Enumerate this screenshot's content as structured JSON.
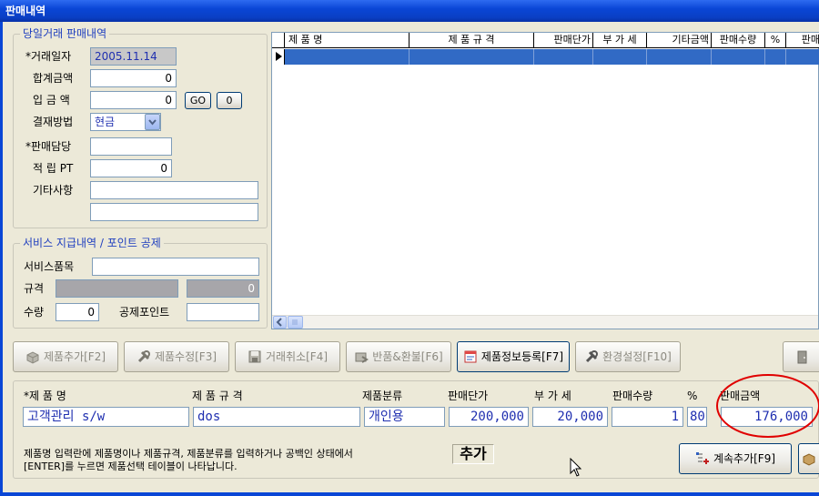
{
  "window": {
    "title": "판매내역"
  },
  "today_sales": {
    "legend": "당일거래 판매내역",
    "date_label": "*거래일자",
    "date_value": "2005.11.14",
    "total_label": "합계금액",
    "total_value": "0",
    "deposit_label": "입 금 액",
    "deposit_value": "0",
    "go_label": "GO",
    "zero_label": "0",
    "payment_label": "결재방법",
    "payment_value": "현금",
    "staff_label": "*판매담당",
    "staff_value": "",
    "points_label": "적 립 PT",
    "points_value": "0",
    "notes_label": "기타사항",
    "notes_value1": "",
    "notes_value2": ""
  },
  "service": {
    "legend": "서비스 지급내역 / 포인트 공제",
    "item_label": "서비스품목",
    "item_value": "",
    "spec_label": "규격",
    "spec_value": "",
    "spec_num": "0",
    "qty_label": "수량",
    "qty_value": "0",
    "deduct_label": "공제포인트",
    "deduct_value": ""
  },
  "grid": {
    "columns": [
      "제  품  명",
      "제  품  규  격",
      "판매단가",
      "부 가 세",
      "기타금액",
      "판매수량",
      "%",
      "판매"
    ]
  },
  "toolbar": {
    "add_product": "제품추가[F2]",
    "edit_product": "제품수정[F3]",
    "cancel_deal": "거래취소[F4]",
    "return_refund": "반품&환불[F6]",
    "product_register": "제품정보등록[F7]",
    "settings": "환경설정[F10]"
  },
  "entry": {
    "headers": {
      "name": "*제  품  명",
      "spec": "제 품 규 격",
      "category": "제품분류",
      "price": "판매단가",
      "vat": "부 가 세",
      "qty": "판매수량",
      "pct": "%",
      "amount": "판매금액"
    },
    "values": {
      "name": "고객관리 s/w",
      "spec": "dos",
      "category": "개인용",
      "price": "200,000",
      "vat": "20,000",
      "qty": "1",
      "pct": "80",
      "amount": "176,000"
    },
    "note_line1": "제품명 입력란에 제품명이나 제품규격, 제품분류를 입력하거나 공백인 상태에서",
    "note_line2": "[ENTER]를 누르면 제품선택 테이블이 나타납니다.",
    "mode_label": "추가",
    "continue_add": "계속추가[F9]"
  },
  "colors": {
    "accent": "#0A46D6",
    "highlight": "#E00000",
    "selection": "#316AC5"
  }
}
